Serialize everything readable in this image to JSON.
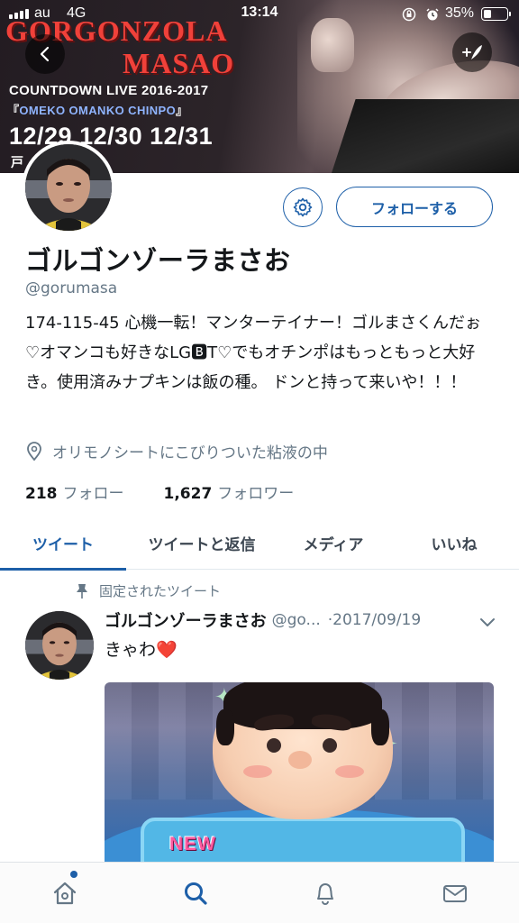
{
  "status_bar": {
    "carrier": "au",
    "network": "4G",
    "time": "13:14",
    "battery_percent_label": "35%",
    "battery_level": 0.35
  },
  "banner": {
    "title_line1": "GORGONZOLA",
    "title_line2": "MASAO",
    "live_title": "COUNTDOWN LIVE 2016-2017",
    "subtitle_open": "『",
    "subtitle_main": "OMEKO OMANKO CHINPO",
    "subtitle_close": "』",
    "dates": "12/29 12/30 12/31",
    "date_extra": "戸"
  },
  "profile": {
    "follow_button": "フォローする",
    "display_name": "ゴルゴンゾーラまさお",
    "handle": "@gorumasa",
    "bio": "174-115-45 心機一転！マンターテイナー！ゴルまさくんだぉ♡オマンコも好きなLG🅱T♡でもオチンポはもっともっと大好き。使用済みナプキンは飯の種。 ドンと持って来いや！！！",
    "location": "オリモノシートにこびりついた粘液の中",
    "following_count": "218",
    "following_label": "フォロー",
    "followers_count": "1,627",
    "followers_label": "フォロワー"
  },
  "tabs": [
    {
      "label": "ツイート",
      "active": true
    },
    {
      "label": "ツイートと返信",
      "active": false
    },
    {
      "label": "メディア",
      "active": false
    },
    {
      "label": "いいね",
      "active": false
    }
  ],
  "pinned_tweet": {
    "pinned_label": "固定されたツイート",
    "name": "ゴルゴンゾーラまさお",
    "handle": "@go...",
    "date": "·2017/09/19",
    "text": "きゃわ",
    "emoji": "❤️",
    "media_badge": "NEW"
  },
  "colors": {
    "accent": "#1d5fa8",
    "secondary_text": "#657786",
    "banner_title": "#f0413a"
  },
  "icons": {
    "back": "chevron-left-icon",
    "compose": "compose-icon",
    "settings": "gear-icon",
    "location": "location-pin-icon",
    "pin": "pin-icon",
    "caret": "chevron-down-icon",
    "home": "home-icon",
    "search": "search-icon",
    "notifications": "bell-icon",
    "messages": "mail-icon"
  }
}
